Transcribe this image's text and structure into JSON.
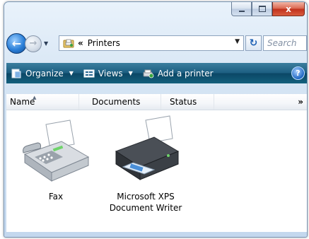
{
  "window": {
    "title_buttons": {
      "minimize": "minimize-icon",
      "maximize": "maximize-icon",
      "close": "close-icon"
    },
    "close_glyph": "x"
  },
  "address_bar": {
    "separator": "«",
    "location": "Printers",
    "search_placeholder": "Search"
  },
  "toolbar": {
    "organize_label": "Organize",
    "views_label": "Views",
    "add_printer_label": "Add a printer",
    "help_glyph": "?"
  },
  "columns": [
    {
      "label": "Name"
    },
    {
      "label": "Documents"
    },
    {
      "label": "Status"
    }
  ],
  "more_columns": "»",
  "items": [
    {
      "name": "Fax",
      "icon": "fax-machine-icon"
    },
    {
      "name_line1": "Microsoft XPS",
      "name_line2": "Document Writer",
      "icon": "printer-icon"
    }
  ],
  "colors": {
    "toolbar": "#1d5f82",
    "frame": "#d3e3f3",
    "close_button": "#c0301c"
  }
}
